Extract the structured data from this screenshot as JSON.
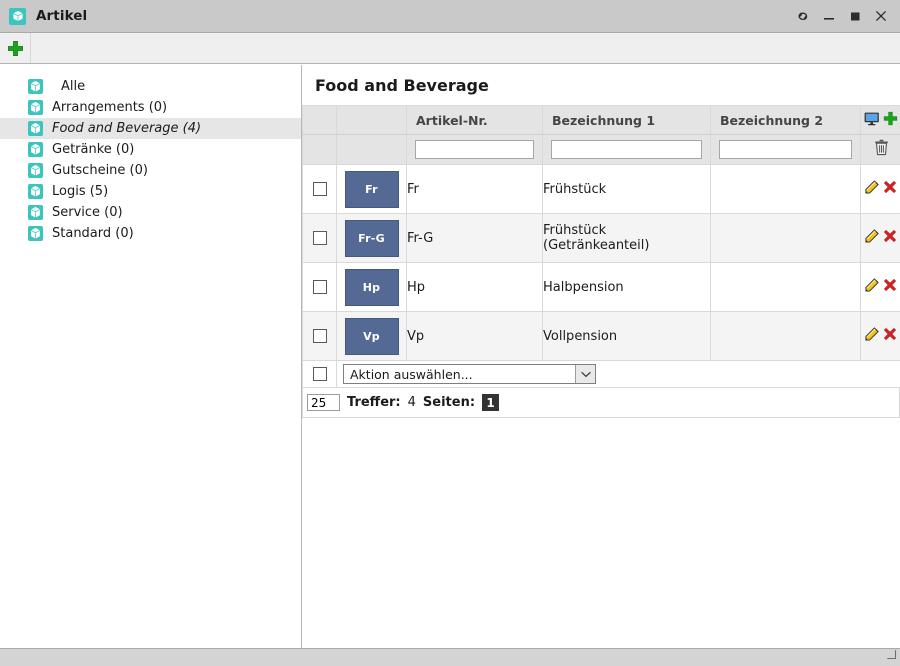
{
  "window": {
    "title": "Artikel",
    "icon": "cube-icon",
    "controls": [
      {
        "name": "restore-icon",
        "label": "↺"
      },
      {
        "name": "minimize-icon",
        "label": "—"
      },
      {
        "name": "maximize-icon",
        "label": "■"
      },
      {
        "name": "close-icon",
        "label": "✕"
      }
    ]
  },
  "toolbar": {
    "add_label": "add-icon"
  },
  "sidebar": {
    "items": [
      {
        "label": "Alle",
        "selected": false
      },
      {
        "label": "Arrangements (0)",
        "selected": false
      },
      {
        "label": "Food and Beverage (4)",
        "selected": true
      },
      {
        "label": "Getränke (0)",
        "selected": false
      },
      {
        "label": "Gutscheine (0)",
        "selected": false
      },
      {
        "label": "Logis (5)",
        "selected": false
      },
      {
        "label": "Service (0)",
        "selected": false
      },
      {
        "label": "Standard (0)",
        "selected": false
      }
    ]
  },
  "main": {
    "page_title": "Food and Beverage",
    "table": {
      "columns": [
        "",
        "",
        "Artikel-Nr.",
        "Bezeichnung 1",
        "Bezeichnung 2",
        ""
      ],
      "header_icons": [
        "monitor-icon",
        "add-icon"
      ],
      "filter_icon": "trash-icon",
      "filters": {
        "artikel_nr": "",
        "bezeichnung1": "",
        "bezeichnung2": ""
      },
      "rows": [
        {
          "badge": "Fr",
          "artikel_nr": "Fr",
          "bezeichnung1": "Frühstück",
          "bezeichnung2": ""
        },
        {
          "badge": "Fr-G",
          "artikel_nr": "Fr-G",
          "bezeichnung1": "Frühstück (Getränkeanteil)",
          "bezeichnung2": ""
        },
        {
          "badge": "Hp",
          "artikel_nr": "Hp",
          "bezeichnung1": "Halbpension",
          "bezeichnung2": ""
        },
        {
          "badge": "Vp",
          "artikel_nr": "Vp",
          "bezeichnung1": "Vollpension",
          "bezeichnung2": ""
        }
      ],
      "row_actions": [
        "edit-icon",
        "delete-icon"
      ]
    },
    "action_bar": {
      "select_value": "Aktion auswählen..."
    },
    "status": {
      "per_page": "25",
      "hits_label": "Treffer:",
      "hits_value": "4",
      "pages_label": "Seiten:",
      "current_page": "1"
    }
  },
  "colors": {
    "accent_teal": "#3cc4bf",
    "badge_blue": "#546a94",
    "add_green": "#1ba41b",
    "delete_red": "#d62020",
    "page_badge": "#333333"
  }
}
